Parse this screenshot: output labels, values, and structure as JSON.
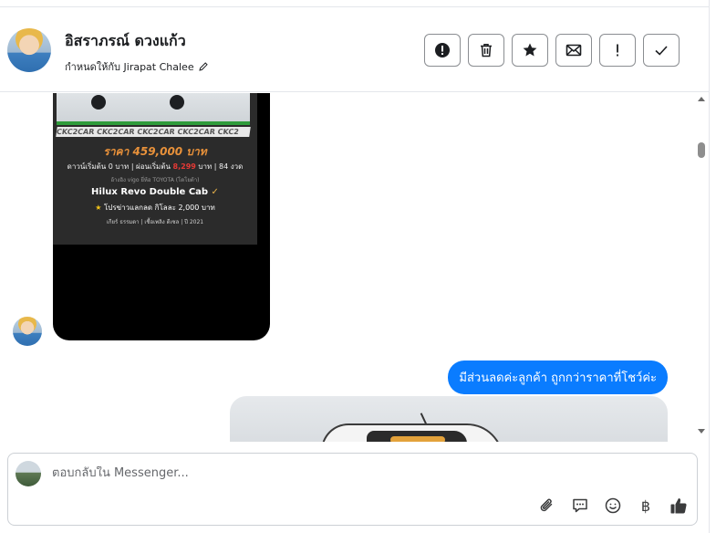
{
  "header": {
    "contact_name": "อิสราภรณ์ ดวงแก้ว",
    "assigned_to": "กำหนดให้กับ Jirapat Chalee",
    "actions": [
      "mark-spam",
      "delete",
      "star",
      "mark-unread",
      "important",
      "done"
    ]
  },
  "conversation": {
    "ad_card": {
      "strip_text": "CKC2CAR CKC2CAR CKC2CAR CKC2CAR CKC2",
      "price": "ราคา 459,000 บาท",
      "finance_prefix": "ดาวน์เริ่มต้น 0 บาท | ผ่อนเริ่มต้น",
      "finance_amount": "8,299",
      "finance_suffix": "บาท | 84 งวด",
      "meta": "อ้างอิง    vigo    ยี่ห้อ   TOYOTA (โตโยต้า)",
      "model": "Hilux Revo Double Cab",
      "promo": "โปรข่าวแลกลด กิโลละ 2,000 บาท",
      "footer": "เกียร์ ธรรมดา   |   เชื้อเพลิง ดีเซล   |   ปี 2021"
    },
    "outgoing_message": "มีส่วนลดค่ะลูกค้า ถูกกว่าราคาที่โชว์ค่ะ"
  },
  "composer": {
    "placeholder": "ตอบกลับใน Messenger...",
    "currency_symbol": "฿"
  },
  "colors": {
    "accent": "#0a7cff",
    "price": "#e8913a",
    "border": "#ccd0d5"
  }
}
